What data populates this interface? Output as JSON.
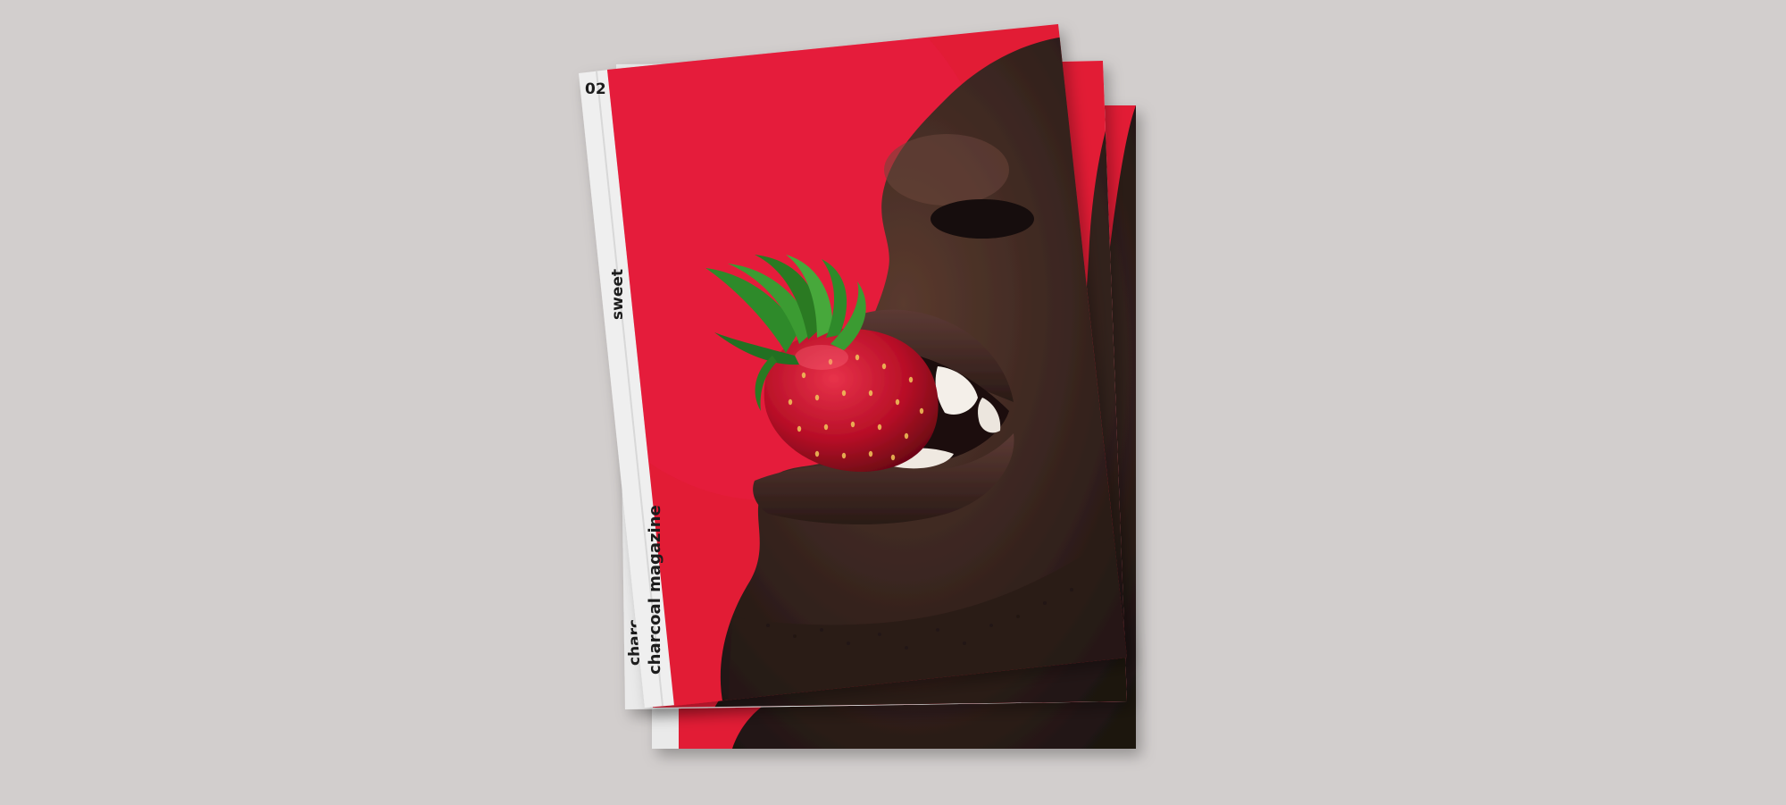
{
  "magazine": {
    "issue_number": "02",
    "issue_title": "sweet",
    "brand_name": "charcoal magazine",
    "brand_name_partial": "charc"
  },
  "colors": {
    "background": "#d2cecd",
    "cover_red": "#e21a36",
    "spine_white": "#eaeaea",
    "skin_dark": "#3a2620",
    "strawberry": "#c8102e",
    "leaf_green": "#2f8a2a"
  },
  "icons": {
    "cover_photo": "strawberry-bite-photo"
  }
}
